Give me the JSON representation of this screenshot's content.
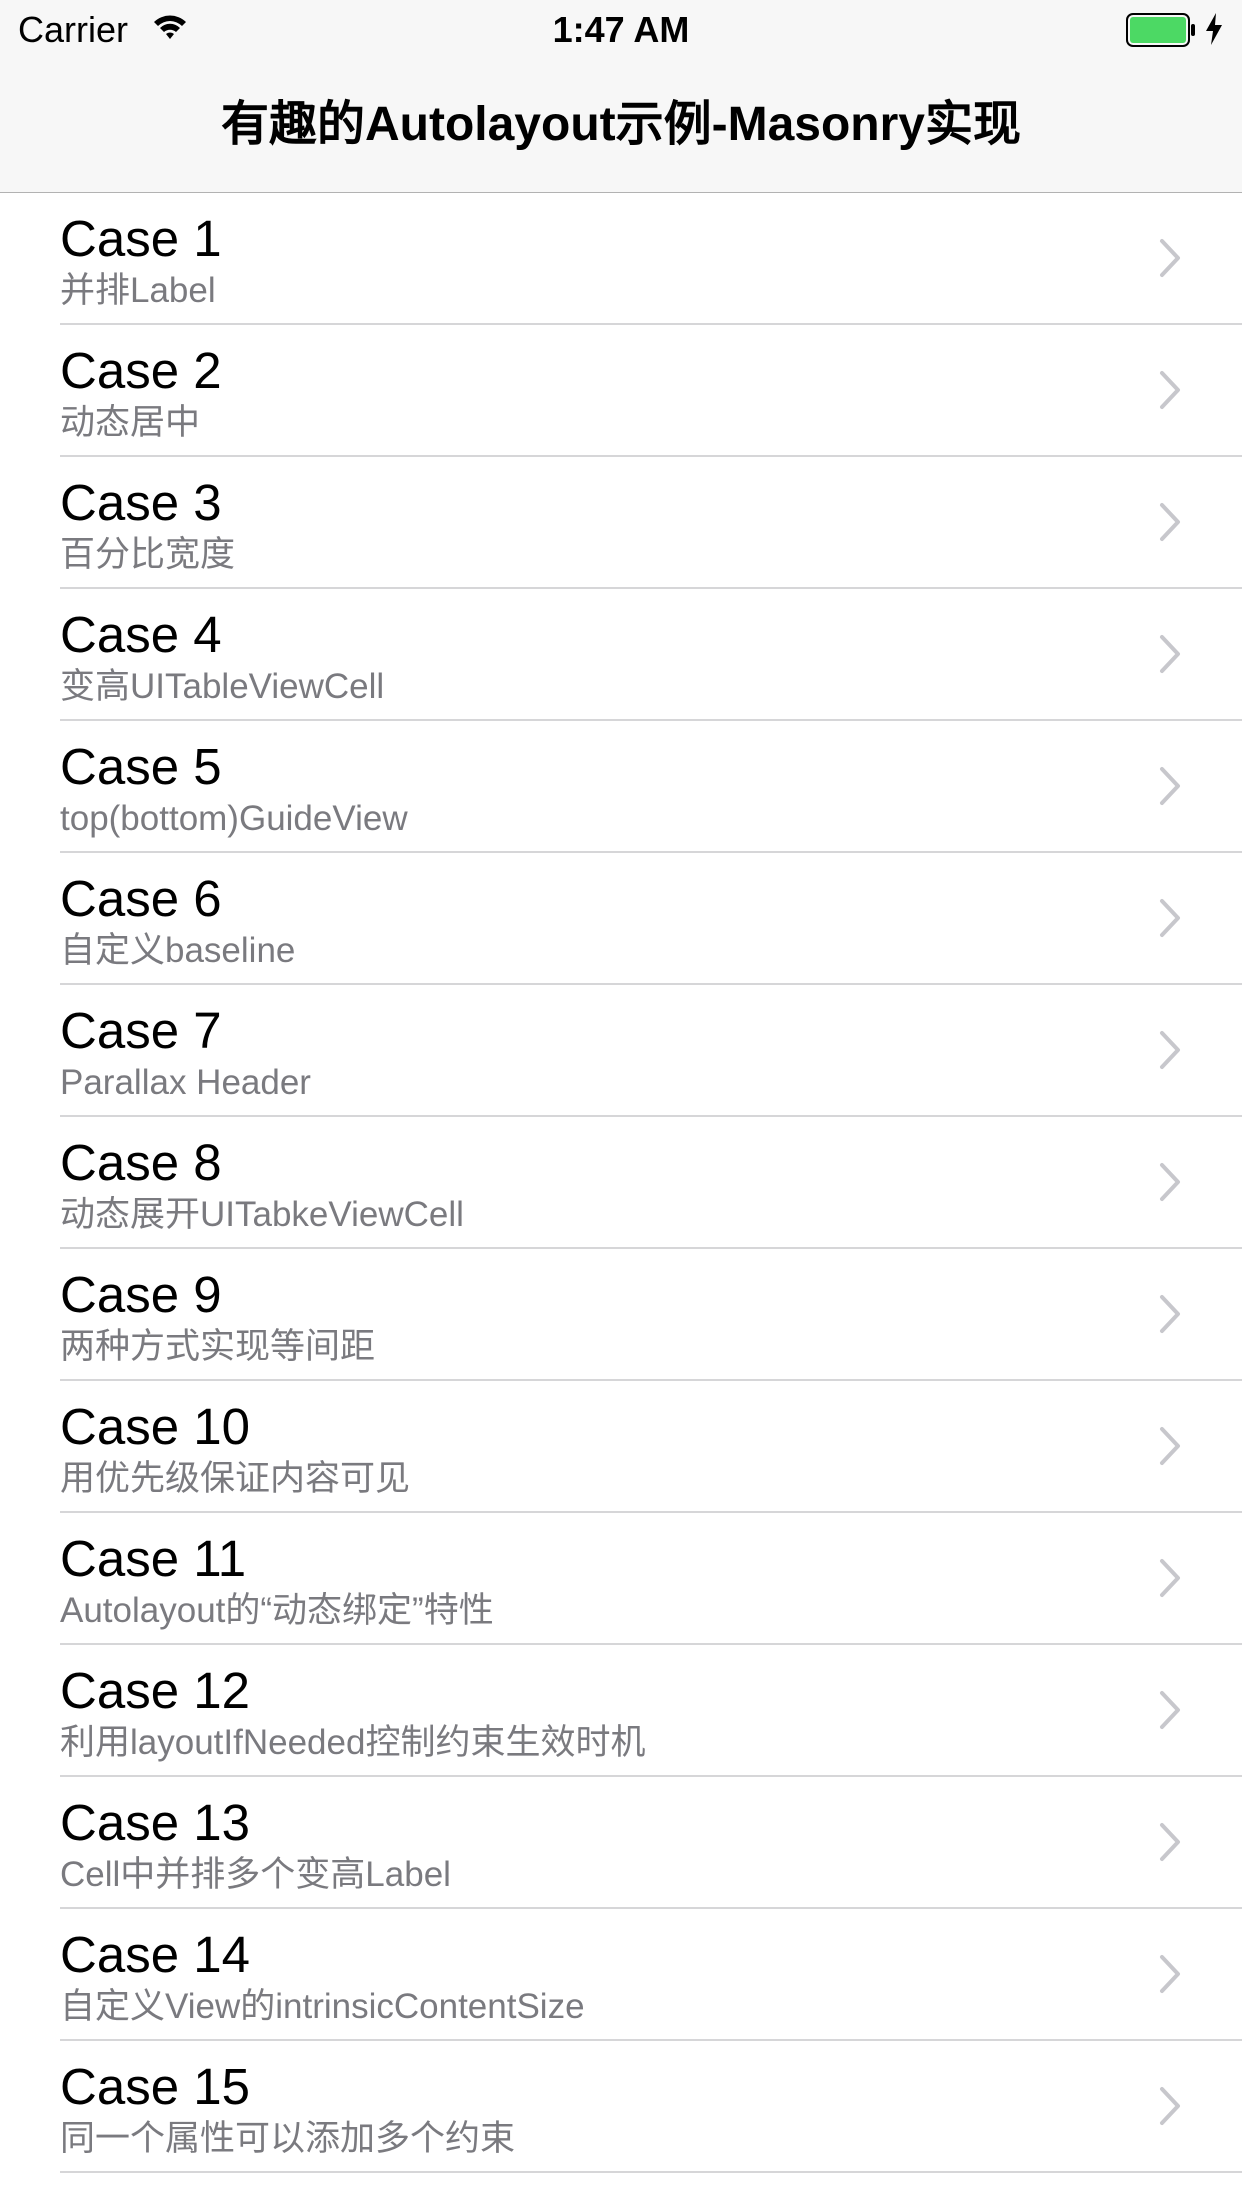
{
  "status_bar": {
    "carrier": "Carrier",
    "time": "1:47 AM",
    "battery_color": "#4cd964"
  },
  "nav": {
    "title": "有趣的Autolayout示例-Masonry实现"
  },
  "cells": [
    {
      "title": "Case 1",
      "subtitle": "并排Label"
    },
    {
      "title": "Case 2",
      "subtitle": "动态居中"
    },
    {
      "title": "Case 3",
      "subtitle": "百分比宽度"
    },
    {
      "title": "Case 4",
      "subtitle": "变高UITableViewCell"
    },
    {
      "title": "Case 5",
      "subtitle": "top(bottom)GuideView"
    },
    {
      "title": "Case 6",
      "subtitle": "自定义baseline"
    },
    {
      "title": "Case 7",
      "subtitle": "Parallax Header"
    },
    {
      "title": "Case 8",
      "subtitle": "动态展开UITabkeViewCell"
    },
    {
      "title": "Case 9",
      "subtitle": "两种方式实现等间距"
    },
    {
      "title": "Case 10",
      "subtitle": "用优先级保证内容可见"
    },
    {
      "title": "Case 11",
      "subtitle": "Autolayout的“动态绑定”特性"
    },
    {
      "title": "Case 12",
      "subtitle": "利用layoutIfNeeded控制约束生效时机"
    },
    {
      "title": "Case 13",
      "subtitle": "Cell中并排多个变高Label"
    },
    {
      "title": "Case 14",
      "subtitle": "自定义View的intrinsicContentSize"
    },
    {
      "title": "Case 15",
      "subtitle": "同一个属性可以添加多个约束"
    }
  ],
  "icons": {
    "wifi": "wifi-icon",
    "battery": "battery-icon",
    "charging": "charging-bolt-icon",
    "disclosure": "chevron-right-icon"
  }
}
